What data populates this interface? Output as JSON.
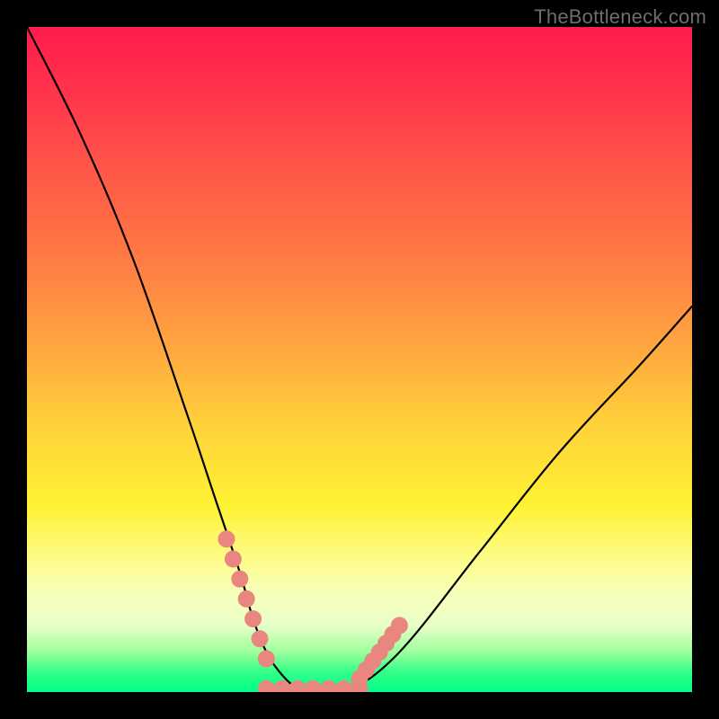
{
  "watermark": "TheBottleneck.com",
  "chart_data": {
    "type": "line",
    "title": "",
    "xlabel": "",
    "ylabel": "",
    "xlim": [
      0,
      100
    ],
    "ylim": [
      0,
      100
    ],
    "grid": false,
    "series": [
      {
        "name": "bottleneck-curve",
        "x": [
          0,
          8,
          16,
          24,
          28,
          32,
          34,
          36,
          38,
          40,
          42,
          44,
          48,
          56,
          68,
          80,
          92,
          100
        ],
        "y": [
          100,
          84,
          65,
          42,
          30,
          18,
          11,
          6,
          3,
          1,
          0,
          0,
          0,
          6,
          21,
          36,
          49,
          58
        ]
      }
    ],
    "annotations": [
      {
        "name": "sweet-zone-left",
        "type": "marker-run",
        "x_range": [
          30,
          36
        ],
        "y_range": [
          23,
          5
        ],
        "color": "#e9867f"
      },
      {
        "name": "sweet-zone-bottom",
        "type": "marker-run",
        "x_range": [
          36,
          50
        ],
        "y_range": [
          0.5,
          0.5
        ],
        "color": "#e9867f"
      },
      {
        "name": "sweet-zone-right",
        "type": "marker-run",
        "x_range": [
          50,
          56
        ],
        "y_range": [
          2,
          10
        ],
        "color": "#e9867f"
      }
    ],
    "background_gradient": {
      "direction": "top-to-bottom",
      "stops": [
        {
          "pos": 0.0,
          "color": "#ff1b4e"
        },
        {
          "pos": 0.72,
          "color": "#fff233"
        },
        {
          "pos": 1.0,
          "color": "#00ff88"
        }
      ]
    }
  }
}
